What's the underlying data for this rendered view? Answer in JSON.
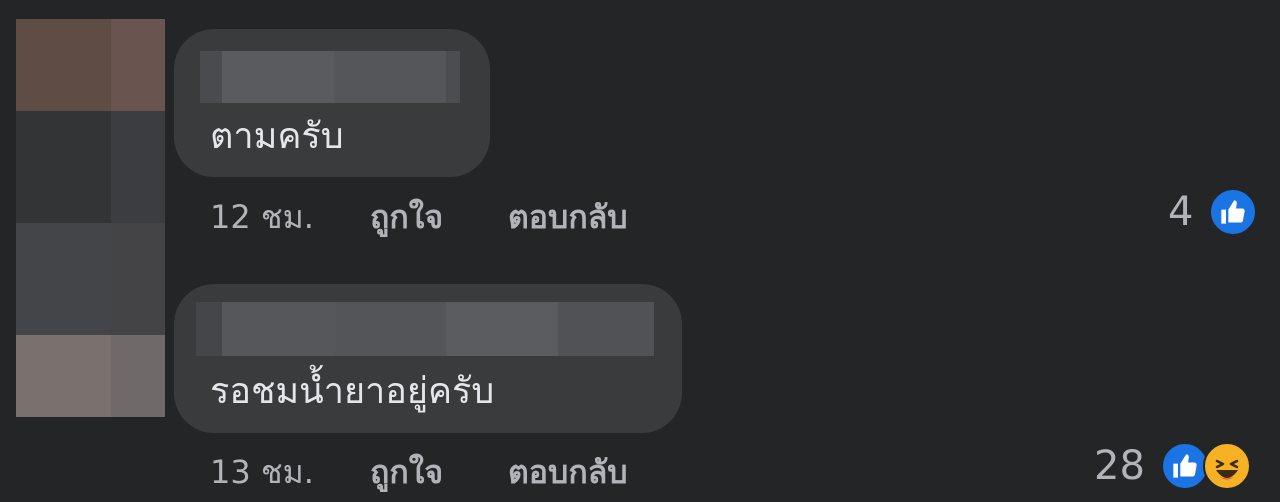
{
  "colors": {
    "background": "#242526",
    "bubble": "#3a3b3c",
    "text_primary": "#e4e6eb",
    "text_secondary": "#b0b3b8",
    "like_blue": "#1b74e4",
    "haha_yellow": "#f7b125"
  },
  "comments": [
    {
      "author_redacted": true,
      "text": "ตามครับ",
      "time": "12 ชม.",
      "like_label": "ถูกใจ",
      "reply_label": "ตอบกลับ",
      "reaction_count": "4",
      "reactions": [
        "like-icon"
      ]
    },
    {
      "author_redacted": true,
      "text": "รอชมน้ำยาอยู่ครับ",
      "time": "13 ชม.",
      "like_label": "ถูกใจ",
      "reply_label": "ตอบกลับ",
      "reaction_count": "28",
      "reactions": [
        "like-icon",
        "haha-icon"
      ]
    }
  ]
}
